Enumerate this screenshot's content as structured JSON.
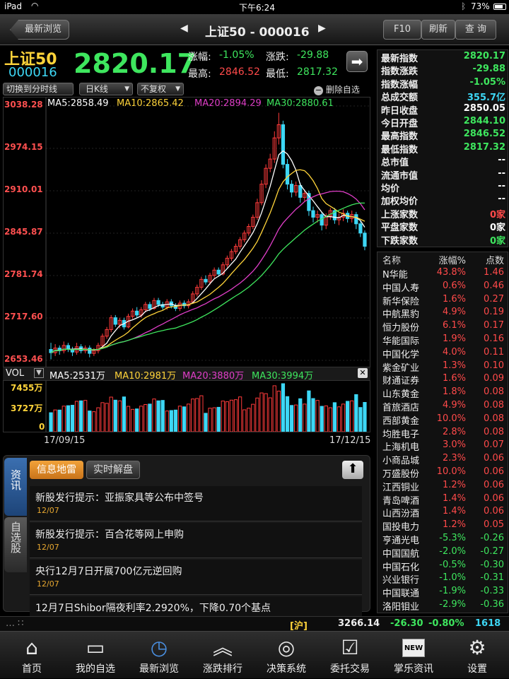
{
  "status": {
    "device": "iPad",
    "time": "下午6:24",
    "battery": "73%"
  },
  "topbar": {
    "back_label": "最新浏览",
    "title": "上证50 - 000016",
    "f10_label": "F10",
    "refresh_label": "刷新",
    "query_label": "查 询"
  },
  "quote": {
    "name": "上证50",
    "code": "000016",
    "price": "2820.17",
    "change_pct_label": "涨幅:",
    "change_pct": "-1.05%",
    "change_label": "涨跌:",
    "change": "-29.88",
    "high_label": "最高:",
    "high": "2846.52",
    "low_label": "最低:",
    "low": "2817.32"
  },
  "toolbar": {
    "switch_label": "切换到分时线",
    "period_label": "日K线",
    "adjust_label": "不复权",
    "delete_label": "删除自选"
  },
  "ma_legend": {
    "ma5": "MA5:2858.49",
    "ma10": "MA10:2865.42",
    "ma20": "MA20:2894.29",
    "ma30": "MA30:2880.61"
  },
  "vol_legend": {
    "label": "VOL",
    "ma5": "MA5:2531万",
    "ma10": "MA10:2981万",
    "ma20": "MA20:3880万",
    "ma30": "MA30:3994万"
  },
  "vol_axis": [
    "7455万",
    "3727万",
    "0"
  ],
  "dates": {
    "start": "17/09/15",
    "end": "17/12/15"
  },
  "chart_data": {
    "type": "candlestick",
    "y_ticks": [
      "3038.28",
      "2974.15",
      "2910.01",
      "2845.87",
      "2781.74",
      "2717.60",
      "2653.46"
    ],
    "ylim": [
      2653.46,
      3038.28
    ],
    "candles": [
      [
        2670,
        2665,
        2680,
        2655
      ],
      [
        2665,
        2672,
        2678,
        2660
      ],
      [
        2672,
        2668,
        2676,
        2662
      ],
      [
        2668,
        2676,
        2682,
        2664
      ],
      [
        2676,
        2670,
        2680,
        2666
      ],
      [
        2670,
        2666,
        2674,
        2660
      ],
      [
        2666,
        2674,
        2680,
        2662
      ],
      [
        2674,
        2668,
        2678,
        2664
      ],
      [
        2668,
        2672,
        2676,
        2664
      ],
      [
        2672,
        2664,
        2676,
        2658
      ],
      [
        2664,
        2668,
        2672,
        2660
      ],
      [
        2668,
        2676,
        2680,
        2664
      ],
      [
        2676,
        2690,
        2694,
        2672
      ],
      [
        2690,
        2700,
        2704,
        2686
      ],
      [
        2700,
        2718,
        2722,
        2696
      ],
      [
        2718,
        2708,
        2722,
        2704
      ],
      [
        2708,
        2714,
        2718,
        2702
      ],
      [
        2714,
        2704,
        2718,
        2700
      ],
      [
        2704,
        2720,
        2724,
        2702
      ],
      [
        2720,
        2728,
        2732,
        2716
      ],
      [
        2728,
        2722,
        2734,
        2718
      ],
      [
        2722,
        2730,
        2734,
        2718
      ],
      [
        2730,
        2738,
        2742,
        2726
      ],
      [
        2738,
        2732,
        2742,
        2728
      ],
      [
        2732,
        2744,
        2748,
        2730
      ],
      [
        2744,
        2738,
        2748,
        2734
      ],
      [
        2738,
        2734,
        2742,
        2730
      ],
      [
        2734,
        2742,
        2746,
        2730
      ],
      [
        2742,
        2736,
        2746,
        2732
      ],
      [
        2736,
        2732,
        2740,
        2728
      ],
      [
        2732,
        2740,
        2744,
        2728
      ],
      [
        2740,
        2736,
        2744,
        2732
      ],
      [
        2736,
        2742,
        2746,
        2732
      ],
      [
        2742,
        2754,
        2758,
        2740
      ],
      [
        2754,
        2764,
        2768,
        2750
      ],
      [
        2764,
        2776,
        2780,
        2760
      ],
      [
        2776,
        2772,
        2782,
        2768
      ],
      [
        2772,
        2782,
        2786,
        2768
      ],
      [
        2782,
        2790,
        2794,
        2778
      ],
      [
        2790,
        2784,
        2794,
        2780
      ],
      [
        2784,
        2798,
        2802,
        2782
      ],
      [
        2798,
        2808,
        2812,
        2794
      ],
      [
        2808,
        2818,
        2822,
        2804
      ],
      [
        2818,
        2826,
        2830,
        2814
      ],
      [
        2826,
        2836,
        2840,
        2822
      ],
      [
        2836,
        2846,
        2850,
        2832
      ],
      [
        2846,
        2856,
        2860,
        2842
      ],
      [
        2856,
        2870,
        2874,
        2852
      ],
      [
        2870,
        2892,
        2898,
        2866
      ],
      [
        2892,
        2920,
        2926,
        2888
      ],
      [
        2920,
        2944,
        2950,
        2914
      ],
      [
        2944,
        2958,
        2966,
        2938
      ],
      [
        2958,
        2990,
        3000,
        2952
      ],
      [
        2990,
        3010,
        3028,
        2980
      ],
      [
        3010,
        2950,
        3016,
        2944
      ],
      [
        2950,
        2920,
        2958,
        2912
      ],
      [
        2920,
        2908,
        2926,
        2900
      ],
      [
        2908,
        2918,
        2924,
        2902
      ],
      [
        2918,
        2900,
        2922,
        2892
      ],
      [
        2900,
        2906,
        2912,
        2894
      ],
      [
        2906,
        2880,
        2910,
        2872
      ],
      [
        2880,
        2870,
        2886,
        2862
      ],
      [
        2870,
        2874,
        2880,
        2862
      ],
      [
        2874,
        2858,
        2878,
        2850
      ],
      [
        2858,
        2872,
        2876,
        2852
      ],
      [
        2872,
        2880,
        2884,
        2866
      ],
      [
        2880,
        2866,
        2884,
        2860
      ],
      [
        2866,
        2870,
        2876,
        2858
      ],
      [
        2870,
        2876,
        2882,
        2864
      ],
      [
        2876,
        2868,
        2880,
        2862
      ],
      [
        2868,
        2874,
        2880,
        2862
      ],
      [
        2874,
        2860,
        2878,
        2852
      ],
      [
        2860,
        2846,
        2864,
        2840
      ],
      [
        2846,
        2826,
        2850,
        2820
      ]
    ],
    "volume_max": 7455
  },
  "news_tabs": {
    "side_info": "资讯",
    "side_watch": "自选股",
    "tab1": "信息地雷",
    "tab2": "实时解盘"
  },
  "news": [
    {
      "title": "新股发行提示：亚振家具等公布中签号",
      "date": "12/07"
    },
    {
      "title": "新股发行提示：百合花等网上申购",
      "date": "12/07"
    },
    {
      "title": "央行12月7日开展700亿元逆回购",
      "date": "12/07"
    },
    {
      "title": "12月7日Shibor隔夜利率2.2920%，下降0.70个基点",
      "date": ""
    }
  ],
  "index_info": [
    {
      "k": "最新指数",
      "v": "2820.17",
      "c": "green"
    },
    {
      "k": "指数涨跌",
      "v": "-29.88",
      "c": "green"
    },
    {
      "k": "指数涨幅",
      "v": "-1.05%",
      "c": "green"
    },
    {
      "k": "总成交额",
      "v": "355.7亿",
      "c": "cyan"
    },
    {
      "k": "昨日收盘",
      "v": "2850.05",
      "c": "white"
    },
    {
      "k": "今日开盘",
      "v": "2844.10",
      "c": "green"
    },
    {
      "k": "最高指数",
      "v": "2846.52",
      "c": "green"
    },
    {
      "k": "最低指数",
      "v": "2817.32",
      "c": "green"
    },
    {
      "k": "总市值",
      "v": "--",
      "c": "white"
    },
    {
      "k": "流通市值",
      "v": "--",
      "c": "white"
    },
    {
      "k": "均价",
      "v": "--",
      "c": "white"
    },
    {
      "k": "加权均价",
      "v": "--",
      "c": "white"
    },
    {
      "k": "上涨家数",
      "v": "0家",
      "c": "red"
    },
    {
      "k": "平盘家数",
      "v": "0家",
      "c": "white"
    },
    {
      "k": "下跌家数",
      "v": "0家",
      "c": "green"
    }
  ],
  "stock_header": {
    "name": "名称",
    "pct": "涨幅%",
    "pts": "点数"
  },
  "stocks": [
    {
      "n": "N华能",
      "p": "43.8%",
      "d": "1.46",
      "c": "red"
    },
    {
      "n": "中国人寿",
      "p": "0.6%",
      "d": "0.46",
      "c": "red"
    },
    {
      "n": "新华保险",
      "p": "1.6%",
      "d": "0.27",
      "c": "red"
    },
    {
      "n": "中航黑豹",
      "p": "4.9%",
      "d": "0.19",
      "c": "red"
    },
    {
      "n": "恒力股份",
      "p": "6.1%",
      "d": "0.17",
      "c": "red"
    },
    {
      "n": "华能国际",
      "p": "1.9%",
      "d": "0.16",
      "c": "red"
    },
    {
      "n": "中国化学",
      "p": "4.0%",
      "d": "0.11",
      "c": "red"
    },
    {
      "n": "紫金矿业",
      "p": "1.3%",
      "d": "0.10",
      "c": "red"
    },
    {
      "n": "财通证券",
      "p": "1.6%",
      "d": "0.09",
      "c": "red"
    },
    {
      "n": "山东黄金",
      "p": "1.8%",
      "d": "0.08",
      "c": "red"
    },
    {
      "n": "首旅酒店",
      "p": "4.9%",
      "d": "0.08",
      "c": "red"
    },
    {
      "n": "西部黄金",
      "p": "10.0%",
      "d": "0.08",
      "c": "red"
    },
    {
      "n": "均胜电子",
      "p": "2.8%",
      "d": "0.08",
      "c": "red"
    },
    {
      "n": "上海机电",
      "p": "3.0%",
      "d": "0.07",
      "c": "red"
    },
    {
      "n": "小商品城",
      "p": "2.3%",
      "d": "0.06",
      "c": "red"
    },
    {
      "n": "万盛股份",
      "p": "10.0%",
      "d": "0.06",
      "c": "red"
    },
    {
      "n": "江西铜业",
      "p": "1.2%",
      "d": "0.06",
      "c": "red"
    },
    {
      "n": "青岛啤酒",
      "p": "1.4%",
      "d": "0.06",
      "c": "red"
    },
    {
      "n": "山西汾酒",
      "p": "1.4%",
      "d": "0.06",
      "c": "red"
    },
    {
      "n": "国投电力",
      "p": "1.2%",
      "d": "0.05",
      "c": "red"
    },
    {
      "n": "亨通光电",
      "p": "-5.3%",
      "d": "-0.26",
      "c": "green"
    },
    {
      "n": "中国国航",
      "p": "-2.0%",
      "d": "-0.27",
      "c": "green"
    },
    {
      "n": "中国石化",
      "p": "-0.5%",
      "d": "-0.30",
      "c": "green"
    },
    {
      "n": "兴业银行",
      "p": "-1.0%",
      "d": "-0.31",
      "c": "green"
    },
    {
      "n": "中国联通",
      "p": "-1.9%",
      "d": "-0.33",
      "c": "green"
    },
    {
      "n": "洛阳钼业",
      "p": "-2.9%",
      "d": "-0.36",
      "c": "green"
    }
  ],
  "ticker": {
    "market": "[沪]",
    "index": "3266.14",
    "change": "-26.30",
    "pct": "-0.80%",
    "amount": "1618亿"
  },
  "tabs": [
    "首页",
    "我的自选",
    "最新浏览",
    "涨跌排行",
    "决策系统",
    "委托交易",
    "掌乐资讯",
    "设置"
  ],
  "tab_icons": [
    "home-icon",
    "folder-icon",
    "clock-icon",
    "chevrons-up-icon",
    "target-icon",
    "checkbox-icon",
    "new-badge-icon",
    "gear-icon"
  ],
  "new_badge": "NEW"
}
